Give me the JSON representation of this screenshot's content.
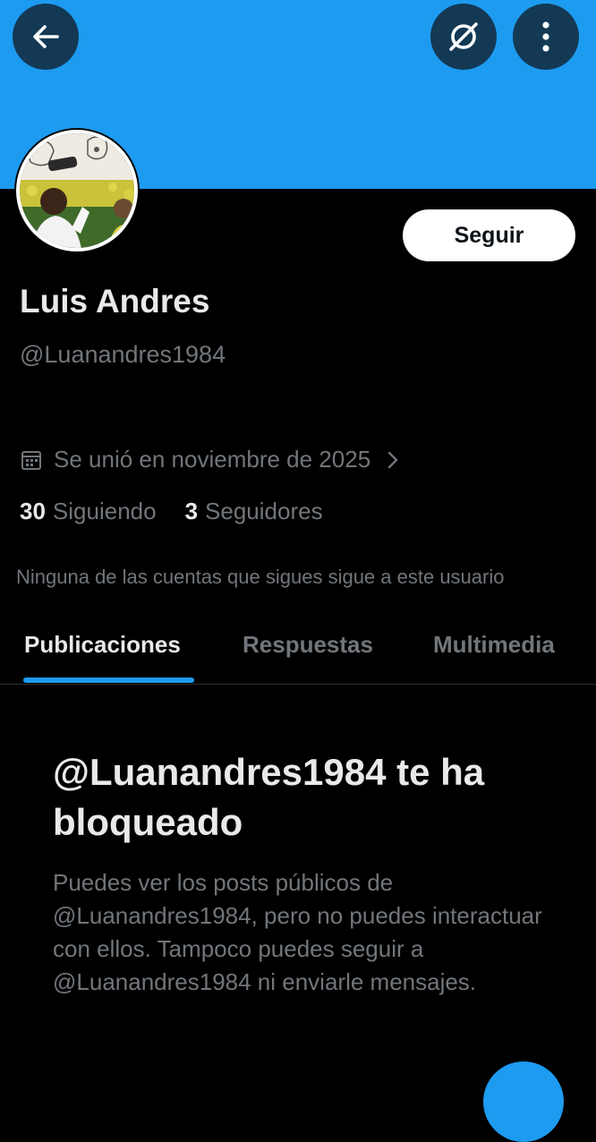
{
  "colors": {
    "banner": "#1d9bf0",
    "background": "#000000",
    "primary_text": "#e7e9ea",
    "secondary_text": "#71767b",
    "accent": "#1d9bf0"
  },
  "header": {
    "back_icon": "arrow-left-icon",
    "grok_icon": "slashed-circle-icon",
    "more_icon": "vertical-dots-icon"
  },
  "profile": {
    "name": "Luis Andres",
    "handle": "@Luanandres1984",
    "joined": "Se unió en noviembre de 2025",
    "joined_icon": "calendar-icon",
    "following_count": "30",
    "following_label": "Siguiendo",
    "followers_count": "3",
    "followers_label": "Seguidores",
    "mutual_note": "Ninguna de las cuentas que sigues sigue a este usuario",
    "follow_label": "Seguir"
  },
  "tabs": [
    {
      "label": "Publicaciones",
      "active": true
    },
    {
      "label": "Respuestas",
      "active": false
    },
    {
      "label": "Multimedia",
      "active": false
    }
  ],
  "blocked": {
    "title": "@Luanandres1984 te ha bloqueado",
    "description": "Puedes ver los posts públicos de @Luanandres1984, pero no puedes interactuar con ellos. Tampoco puedes seguir a @Luanandres1984 ni enviarle mensajes."
  }
}
